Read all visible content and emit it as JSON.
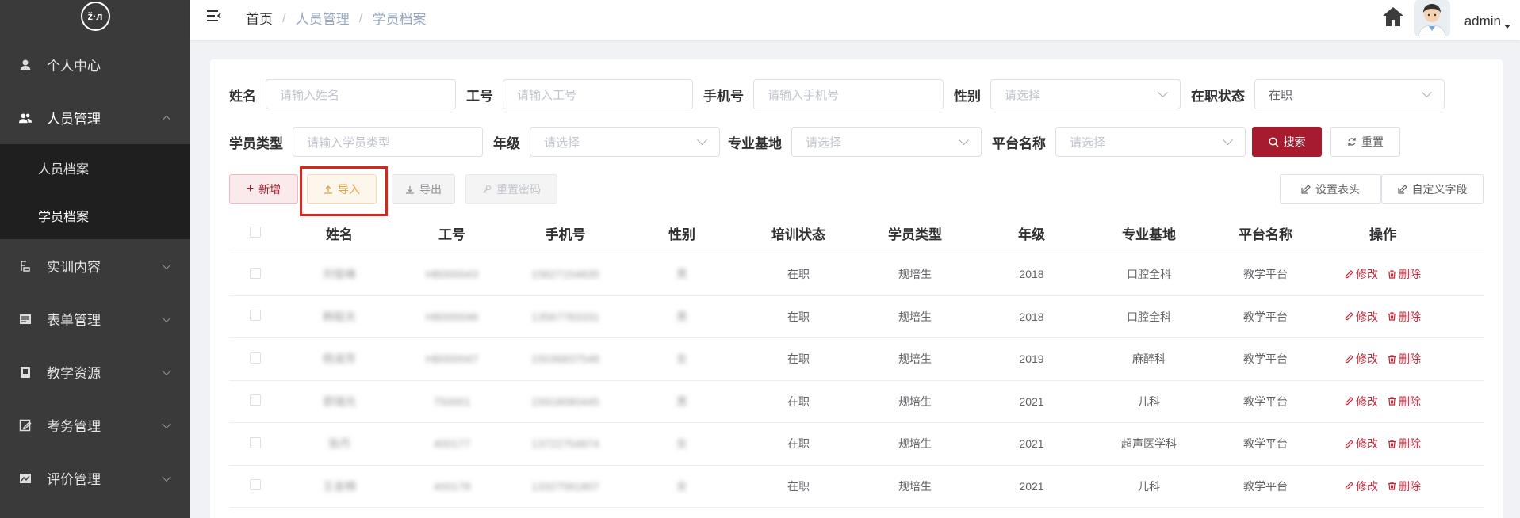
{
  "sidebar": {
    "logo_text": "ž·л",
    "items": [
      {
        "label": "个人中心",
        "icon": "user-icon"
      },
      {
        "label": "人员管理",
        "icon": "users-icon"
      },
      {
        "label": "实训内容",
        "icon": "training-icon"
      },
      {
        "label": "表单管理",
        "icon": "form-icon"
      },
      {
        "label": "教学资源",
        "icon": "resource-icon"
      },
      {
        "label": "考务管理",
        "icon": "exam-icon"
      },
      {
        "label": "评价管理",
        "icon": "evaluation-icon"
      }
    ],
    "submenu": [
      {
        "label": "人员档案"
      },
      {
        "label": "学员档案"
      }
    ]
  },
  "header": {
    "breadcrumb": [
      "首页",
      "人员管理",
      "学员档案"
    ],
    "breadcrumb_sep": "/",
    "user_name": "admin"
  },
  "filters": {
    "name": {
      "label": "姓名",
      "placeholder": "请输入姓名"
    },
    "job_no": {
      "label": "工号",
      "placeholder": "请输入工号"
    },
    "phone": {
      "label": "手机号",
      "placeholder": "请输入手机号"
    },
    "gender": {
      "label": "性别",
      "placeholder": "请选择"
    },
    "status": {
      "label": "在职状态",
      "value": "在职"
    },
    "student_type": {
      "label": "学员类型",
      "placeholder": "请输入学员类型"
    },
    "grade": {
      "label": "年级",
      "placeholder": "请选择"
    },
    "base": {
      "label": "专业基地",
      "placeholder": "请选择"
    },
    "platform": {
      "label": "平台名称",
      "placeholder": "请选择"
    },
    "search_label": "搜索",
    "reset_label": "重置"
  },
  "toolbar": {
    "add_label": "新增",
    "import_label": "导入",
    "export_label": "导出",
    "reset_pwd_label": "重置密码",
    "set_header_label": "设置表头",
    "custom_field_label": "自定义字段"
  },
  "table": {
    "headers": [
      "姓名",
      "工号",
      "手机号",
      "性别",
      "培训状态",
      "学员类型",
      "年级",
      "专业基地",
      "平台名称",
      "操作"
    ],
    "edit_label": "修改",
    "delete_label": "删除",
    "rows": [
      {
        "name": "刘俊峰",
        "job_no": "HB000043",
        "phone": "15627154835",
        "gender": "男",
        "status": "在职",
        "type": "规培生",
        "grade": "2018",
        "base": "口腔全科",
        "platform": "教学平台"
      },
      {
        "name": "韩聪天",
        "job_no": "HB000046",
        "phone": "13567783331",
        "gender": "男",
        "status": "在职",
        "type": "规培生",
        "grade": "2018",
        "base": "口腔全科",
        "platform": "教学平台"
      },
      {
        "name": "杨淑芳",
        "job_no": "HB000047",
        "phone": "15036837548",
        "gender": "女",
        "status": "在职",
        "type": "规培生",
        "grade": "2019",
        "base": "麻醉科",
        "platform": "教学平台"
      },
      {
        "name": "郭瑞光",
        "job_no": "750001",
        "phone": "15918080445",
        "gender": "男",
        "status": "在职",
        "type": "规培生",
        "grade": "2021",
        "base": "儿科",
        "platform": "教学平台"
      },
      {
        "name": "张丹",
        "job_no": "400177",
        "phone": "13722754874",
        "gender": "女",
        "status": "在职",
        "type": "规培生",
        "grade": "2021",
        "base": "超声医学科",
        "platform": "教学平台"
      },
      {
        "name": "王金楠",
        "job_no": "400178",
        "phone": "13327581807",
        "gender": "女",
        "status": "在职",
        "type": "规培生",
        "grade": "2021",
        "base": "儿科",
        "platform": "教学平台"
      }
    ]
  },
  "colors": {
    "accent": "#a61c2e",
    "sidebar_bg": "#3a3a3a",
    "submenu_bg": "#1f1f1f",
    "highlight": "#d9261c"
  }
}
